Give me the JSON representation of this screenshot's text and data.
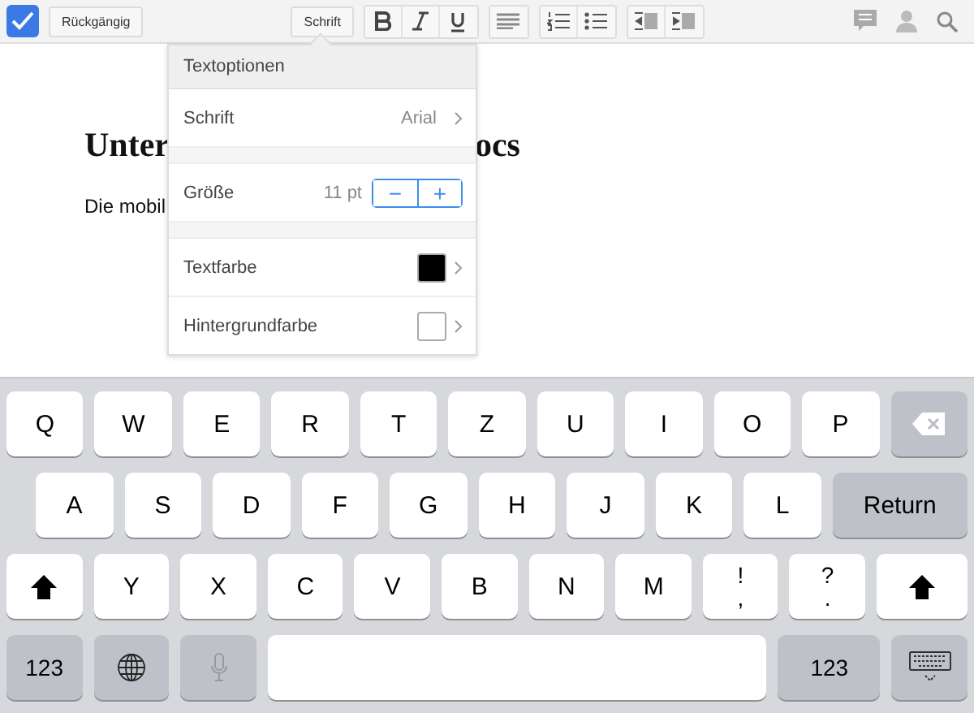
{
  "toolbar": {
    "undo": "Rückgängig",
    "font_button": "Schrift"
  },
  "document": {
    "heading_left": "Unter",
    "heading_right": "ocs",
    "paragraph": "Die mobil"
  },
  "popover": {
    "title": "Textoptionen",
    "font_label": "Schrift",
    "font_value": "Arial",
    "size_label": "Größe",
    "size_value": "11 pt",
    "minus": "−",
    "plus": "+",
    "colors": [
      {
        "label": "Textfarbe",
        "color": "#000000"
      },
      {
        "label": "Hintergrundfarbe",
        "color": "#ffffff"
      }
    ]
  },
  "keyboard": {
    "rows": [
      {
        "keys": [
          {
            "kind": "letter",
            "label": "Q"
          },
          {
            "kind": "letter",
            "label": "W"
          },
          {
            "kind": "letter",
            "label": "E"
          },
          {
            "kind": "letter",
            "label": "R"
          },
          {
            "kind": "letter",
            "label": "T"
          },
          {
            "kind": "letter",
            "label": "Z"
          },
          {
            "kind": "letter",
            "label": "U"
          },
          {
            "kind": "letter",
            "label": "I"
          },
          {
            "kind": "letter",
            "label": "O"
          },
          {
            "kind": "letter",
            "label": "P"
          },
          {
            "kind": "backspace"
          }
        ]
      },
      {
        "keys": [
          {
            "kind": "letter",
            "label": "A"
          },
          {
            "kind": "letter",
            "label": "S"
          },
          {
            "kind": "letter",
            "label": "D"
          },
          {
            "kind": "letter",
            "label": "F"
          },
          {
            "kind": "letter",
            "label": "G"
          },
          {
            "kind": "letter",
            "label": "H"
          },
          {
            "kind": "letter",
            "label": "J"
          },
          {
            "kind": "letter",
            "label": "K"
          },
          {
            "kind": "letter",
            "label": "L"
          },
          {
            "kind": "return",
            "label": "Return"
          }
        ]
      },
      {
        "keys": [
          {
            "kind": "shift"
          },
          {
            "kind": "letter",
            "label": "Y"
          },
          {
            "kind": "letter",
            "label": "X"
          },
          {
            "kind": "letter",
            "label": "C"
          },
          {
            "kind": "letter",
            "label": "V"
          },
          {
            "kind": "letter",
            "label": "B"
          },
          {
            "kind": "letter",
            "label": "N"
          },
          {
            "kind": "letter",
            "label": "M"
          },
          {
            "kind": "dual",
            "top": "!",
            "bottom": ","
          },
          {
            "kind": "dual",
            "top": "?",
            "bottom": "."
          },
          {
            "kind": "shift"
          }
        ]
      },
      {
        "keys": [
          {
            "kind": "num",
            "label": "123"
          },
          {
            "kind": "globe"
          },
          {
            "kind": "mic"
          },
          {
            "kind": "space"
          },
          {
            "kind": "num",
            "label": "123"
          },
          {
            "kind": "hide"
          }
        ]
      }
    ]
  }
}
